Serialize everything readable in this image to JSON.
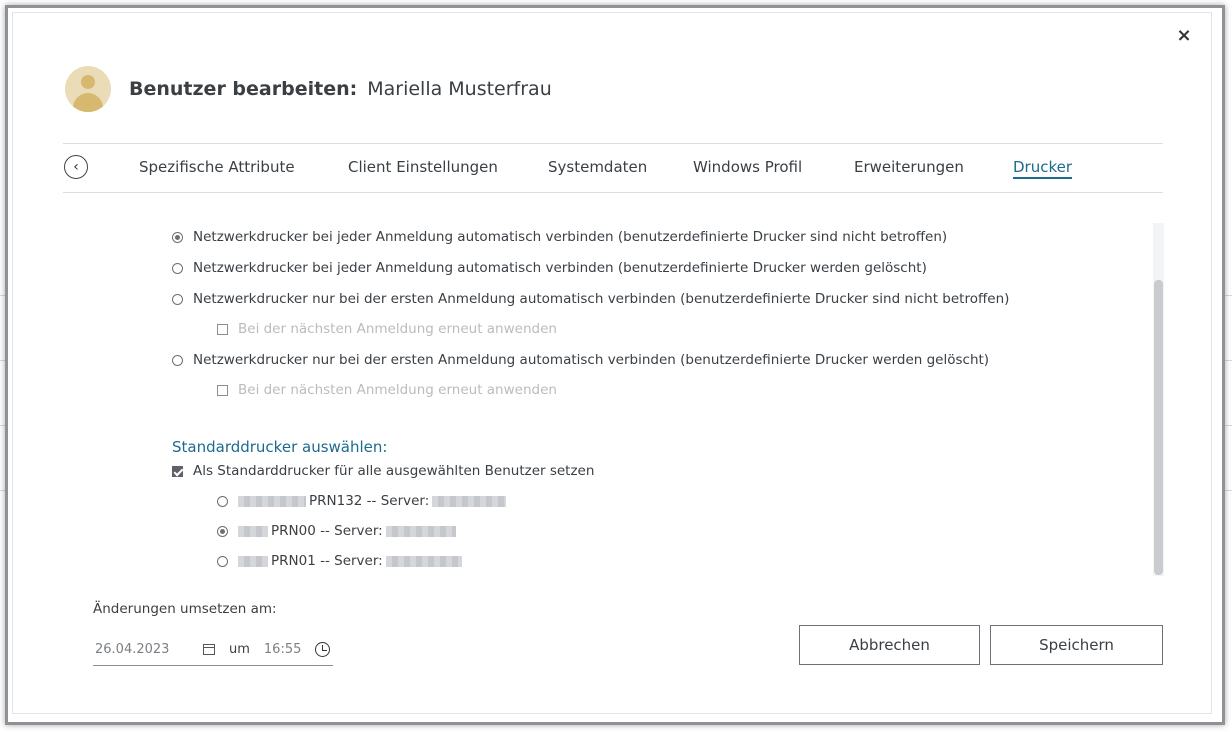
{
  "dialog": {
    "title_label": "Benutzer bearbeiten:",
    "user_name": "Mariella Musterfrau",
    "close_label": "×"
  },
  "tabs": [
    {
      "label": "Spezifische Attribute"
    },
    {
      "label": "Client Einstellungen"
    },
    {
      "label": "Systemdaten"
    },
    {
      "label": "Windows Profil"
    },
    {
      "label": "Erweiterungen"
    },
    {
      "label": "Drucker",
      "active": true
    }
  ],
  "options": {
    "connect_always_keep": "Netzwerkdrucker bei jeder Anmeldung automatisch verbinden (benutzerdefinierte Drucker sind nicht betroffen)",
    "connect_always_delete": "Netzwerkdrucker bei jeder Anmeldung automatisch verbinden (benutzerdefinierte Drucker werden gelöscht)",
    "connect_first_keep": "Netzwerkdrucker nur bei der ersten Anmeldung automatisch verbinden (benutzerdefinierte Drucker sind nicht betroffen)",
    "reapply_1": "Bei der nächsten Anmeldung erneut anwenden",
    "connect_first_delete": "Netzwerkdrucker nur bei der ersten Anmeldung automatisch verbinden (benutzerdefinierte Drucker werden gelöscht)",
    "reapply_2": "Bei der nächsten Anmeldung erneut anwenden"
  },
  "default_printer": {
    "section_title": "Standarddrucker auswählen:",
    "set_for_all": "Als Standarddrucker für alle ausgewählten Benutzer setzen",
    "printers": [
      {
        "name": "PRN132 -- Server:",
        "selected": false
      },
      {
        "name": "PRN00 -- Server:",
        "selected": true
      },
      {
        "name": "PRN01 -- Server:",
        "selected": false
      }
    ]
  },
  "footer": {
    "apply_label": "Änderungen umsetzen am:",
    "date": "26.04.2023",
    "um": "um",
    "time": "16:55",
    "cancel": "Abbrechen",
    "save": "Speichern"
  },
  "colors": {
    "accent": "#1d6b8e"
  }
}
